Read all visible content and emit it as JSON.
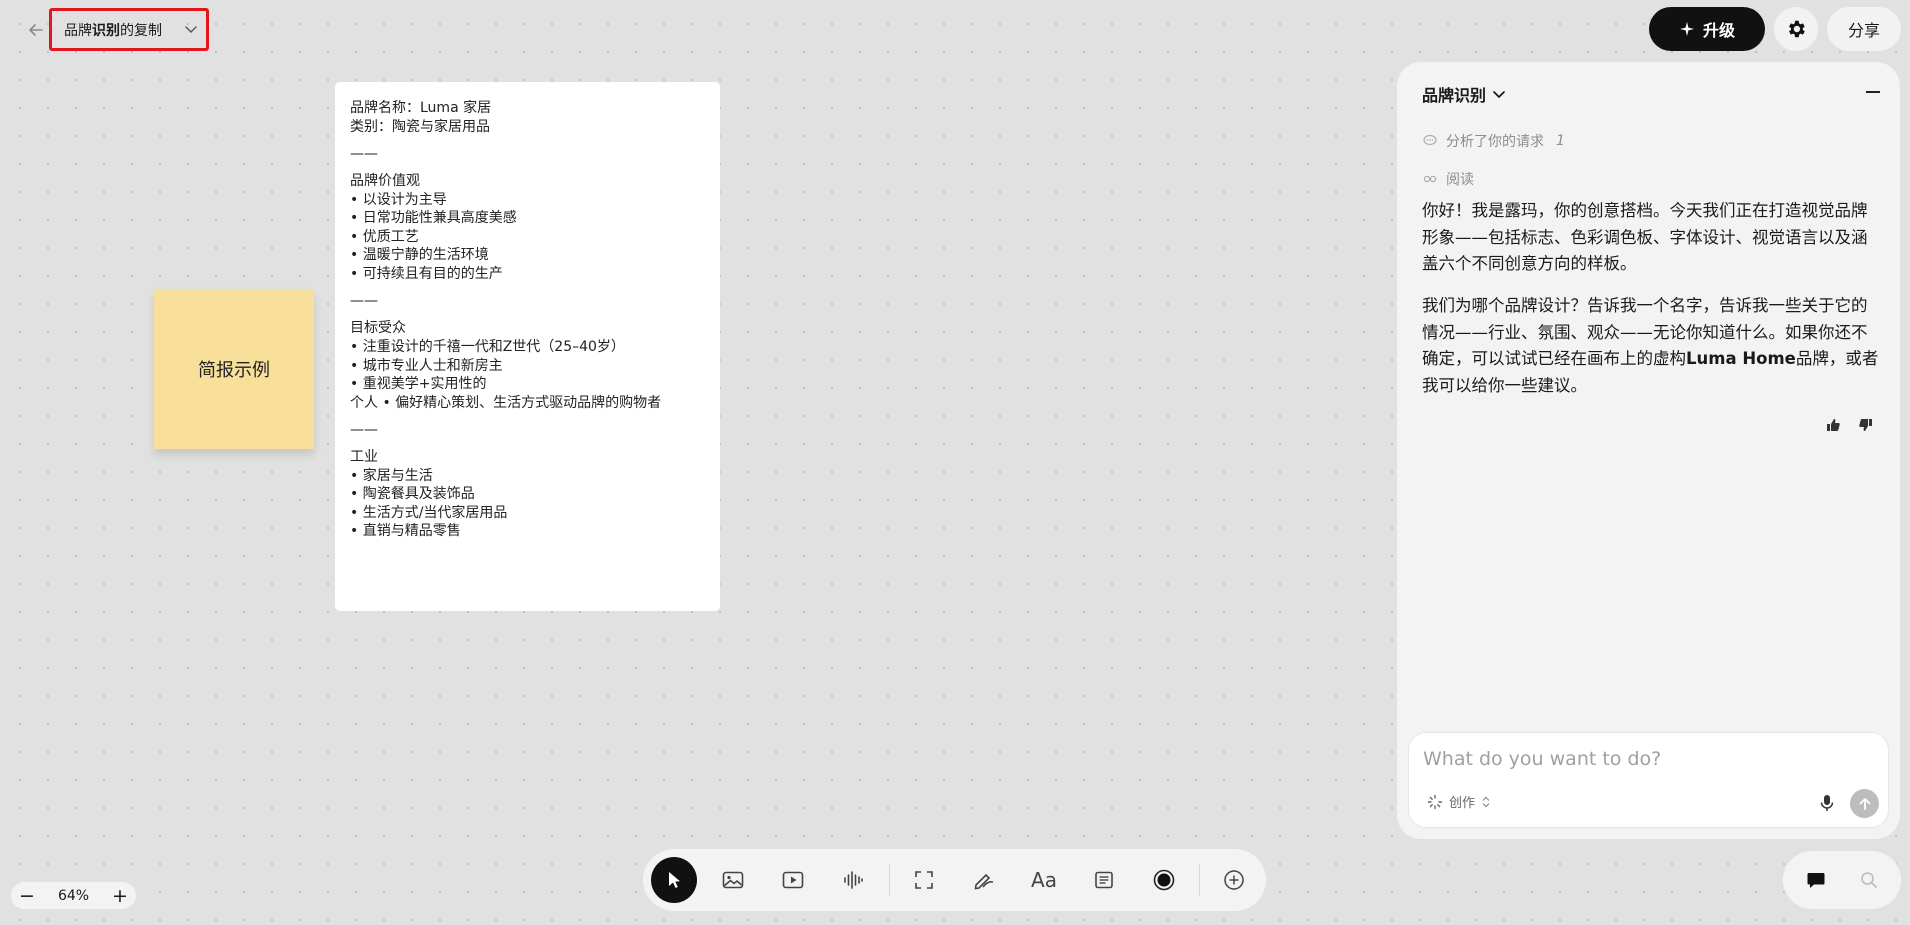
{
  "header": {
    "back_icon": "arrow-left-icon",
    "title_part1": "品牌",
    "title_part2": "识别",
    "title_part3": "的复制",
    "upgrade_label": "升级",
    "share_label": "分享"
  },
  "canvas": {
    "sticky_note": {
      "text": "简报示例",
      "color": "#f8df9a"
    },
    "brief_card": {
      "lines": [
        "品牌名称：Luma 家居",
        "类别：陶瓷与家居用品",
        "",
        "——",
        "",
        "品牌价值观",
        " • 以设计为主导",
        " • 日常功能性兼具高度美感",
        " • 优质工艺",
        " • 温暖宁静的生活环境",
        " • 可持续且有目的的生产",
        "",
        "——",
        "",
        "目标受众",
        " • 注重设计的千禧一代和Z世代（25–40岁）",
        "• 城市专业人士和新房主",
        " • 重视美学+实用性的",
        "个人 • 偏好精心策划、生活方式驱动品牌的购物者",
        "",
        "——",
        "",
        "工业",
        " • 家居与生活",
        " • 陶瓷餐具及装饰品",
        " • 生活方式/当代家居用品",
        " • 直销与精品零售"
      ]
    }
  },
  "chat": {
    "title": "品牌识别",
    "steps": [
      {
        "label": "分析了你的请求",
        "count": "1"
      },
      {
        "label": "阅读"
      }
    ],
    "message1": "你好！我是露玛，你的创意搭档。今天我们正在打造视觉品牌形象——包括标志、色彩调色板、字体设计、视觉语言以及涵盖六个不同创意方向的样板。",
    "message2_before": "我们为哪个品牌设计？告诉我一个名字，告诉我一些关于它的情况——行业、氛围、观众——无论你知道什么。如果你还不确定，可以试试已经在画布上的虚构",
    "message2_bold": "Luma Home",
    "message2_after": "品牌，或者我可以给你一些建议。",
    "input_placeholder": "What do you want to do?",
    "input_value": "",
    "mode_label": "创作"
  },
  "toolbar": {
    "tools": [
      "pointer-icon",
      "image-icon",
      "video-icon",
      "audio-icon",
      "frame-icon",
      "draw-icon",
      "text-icon",
      "note-icon",
      "record-icon",
      "add-icon"
    ],
    "text_tool_label": "Aa",
    "active_tool": "pointer-icon"
  },
  "zoom": {
    "minus": "−",
    "level": "64%",
    "plus": "+"
  },
  "colors": {
    "accent": "#111111",
    "highlight_border": "#e0181e",
    "canvas_bg": "#e1e1e1"
  }
}
